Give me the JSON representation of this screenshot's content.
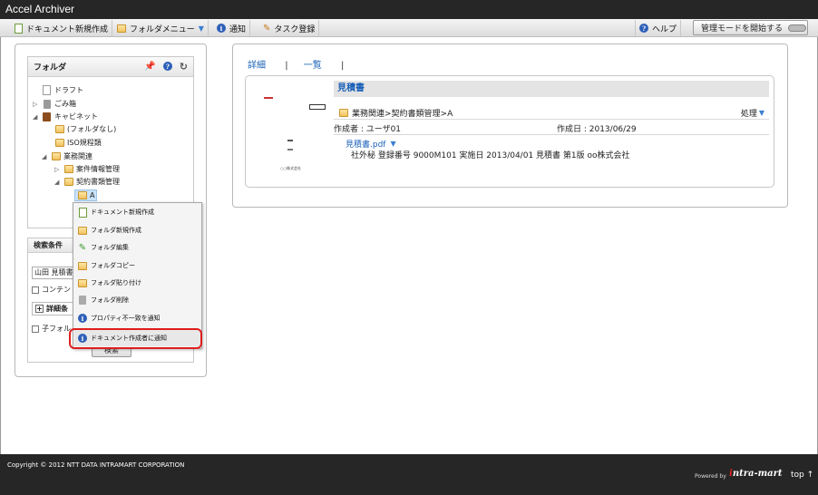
{
  "app": {
    "title": "Accel Archiver"
  },
  "toolbar": {
    "new_doc": "ドキュメント新規作成",
    "folder_menu": "フォルダメニュー",
    "notice": "通知",
    "task": "タスク登録",
    "help": "ヘルプ",
    "admin_mode": "管理モードを開始する"
  },
  "folder_panel": {
    "title": "フォルダ",
    "tree": {
      "draft": "ドラフト",
      "trash": "ごみ箱",
      "cabinet": "キャビネット",
      "no_folder": "(フォルダなし)",
      "iso": "ISO規程類",
      "business": "業務関連",
      "case_info": "案件情報管理",
      "contract": "契約書類管理",
      "a": "A"
    }
  },
  "context_menu": {
    "items": [
      "ドキュメント新規作成",
      "フォルダ新規作成",
      "フォルダ編集",
      "フォルダコピー",
      "フォルダ貼り付け",
      "フォルダ削除",
      "プロパティ不一致を通知",
      "ドキュメント作成者に通知"
    ]
  },
  "search_panel": {
    "title": "検索条件",
    "keyword_value": "山田 見積書",
    "content_check": "コンテン",
    "detail_condition": "詳細条",
    "subfolder_check": "子フォル",
    "search_button": "検索"
  },
  "main": {
    "tabs": [
      "詳細",
      "一覧"
    ],
    "doc_title": "見積書",
    "path": "業務関連>契約書類管理>A",
    "action": "処理",
    "creator": "作成者 : ユーザ01",
    "created_date": "作成日 : 2013/06/29",
    "file_name": "見積書.pdf",
    "description": "社外秘 登録番号 9000M101 実施日 2013/04/01 見積書 第1版 oo株式会社",
    "thumb_company": "○○株式会社"
  },
  "footer": {
    "copyright": "Copyright © 2012 NTT DATA INTRAMART CORPORATION",
    "powered_by": "Powered by",
    "brand": "intra-mart",
    "top_link": "top ↑"
  },
  "colors": {
    "accent_blue": "#1b62b8",
    "highlight_red": "#e01e1e",
    "header_dark": "#262626"
  }
}
